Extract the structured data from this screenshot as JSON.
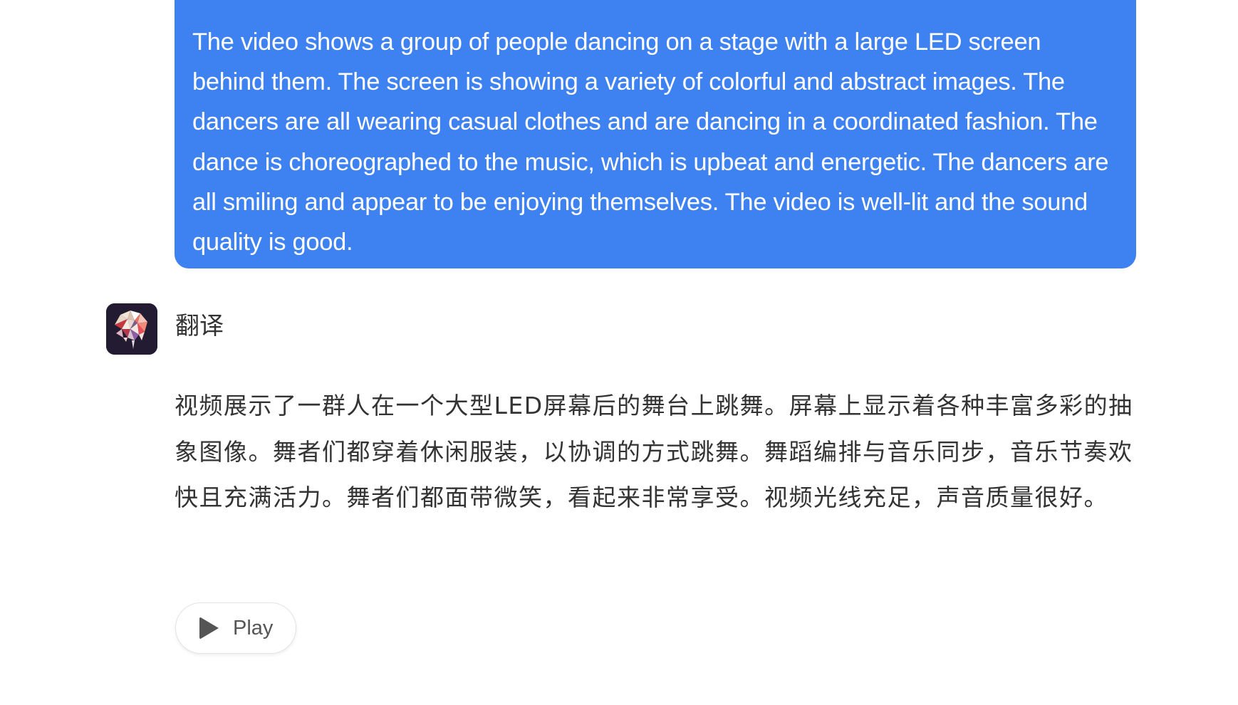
{
  "user_message": {
    "text": "The video shows a group of people dancing on a stage with a large LED screen behind them. The screen is showing a variety of colorful and abstract images. The dancers are all wearing casual clothes and are dancing in a coordinated fashion. The dance is choreographed to the music, which is upbeat and energetic. The dancers are all smiling and appear to be enjoying themselves. The video is well-lit and the sound quality is good.",
    "bubble_color": "#3e82f1"
  },
  "bot": {
    "name": "翻译",
    "avatar_icon": "polygon-brain-icon",
    "message": "视频展示了一群人在一个大型LED屏幕后的舞台上跳舞。屏幕上显示着各种丰富多彩的抽象图像。舞者们都穿着休闲服装，以协调的方式跳舞。舞蹈编排与音乐同步，音乐节奏欢快且充满活力。舞者们都面带微笑，看起来非常享受。视频光线充足，声音质量很好。"
  },
  "actions": {
    "play_label": "Play",
    "play_icon": "play-icon"
  }
}
